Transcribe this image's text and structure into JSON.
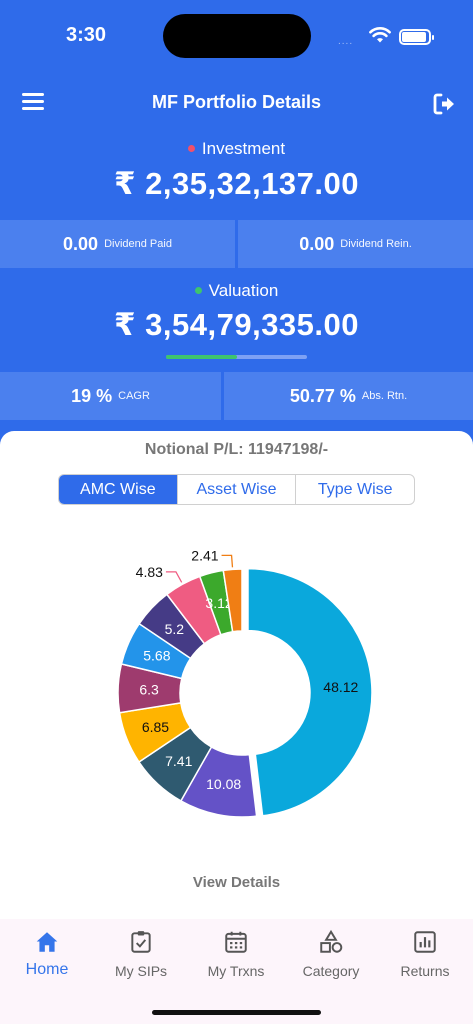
{
  "status_bar": {
    "time": "3:30",
    "signal": "....",
    "wifi_icon": "wifi-icon",
    "battery_icon": "battery-icon"
  },
  "header": {
    "title": "MF Portfolio Details",
    "menu_icon": "menu-icon",
    "logout_icon": "logout-icon"
  },
  "investment": {
    "label": "Investment",
    "dot_color": "#f2506a",
    "amount": "₹ 2,35,32,137.00",
    "stats": [
      {
        "value": "0.00",
        "label": "Dividend Paid"
      },
      {
        "value": "0.00",
        "label": "Dividend Rein."
      }
    ]
  },
  "valuation": {
    "label": "Valuation",
    "dot_color": "#3ec46d",
    "amount": "₹ 3,54,79,335.00",
    "progress_fraction": 0.5,
    "stats": [
      {
        "value": "19 %",
        "label": "CAGR"
      },
      {
        "value": "50.77 %",
        "label": "Abs. Rtn."
      }
    ]
  },
  "card": {
    "notional_pl": "Notional P/L: 11947198/-",
    "tabs": [
      "AMC Wise",
      "Asset Wise",
      "Type Wise"
    ],
    "active_tab": "AMC Wise",
    "view_details": "View Details"
  },
  "chart_data": {
    "type": "pie",
    "values": [
      48.12,
      10.08,
      7.41,
      6.85,
      6.3,
      5.68,
      5.2,
      4.83,
      3.12,
      2.41
    ],
    "colors": [
      "#0aa8dc",
      "#6452c7",
      "#2f5a70",
      "#ffb400",
      "#9e3b6e",
      "#2394ea",
      "#453b86",
      "#ef5c82",
      "#3ca92c",
      "#f07e14"
    ]
  },
  "tab_bar": {
    "items": [
      {
        "label": "Home",
        "icon": "home-icon"
      },
      {
        "label": "My SIPs",
        "icon": "clipboard-check-icon"
      },
      {
        "label": "My Trxns",
        "icon": "calendar-icon"
      },
      {
        "label": "Category",
        "icon": "shapes-icon"
      },
      {
        "label": "Returns",
        "icon": "bar-chart-icon"
      }
    ],
    "active": "Home",
    "active_color": "#3575ea"
  },
  "theme": {
    "primary": "#2f6bea",
    "cell": "#4b80ee"
  }
}
